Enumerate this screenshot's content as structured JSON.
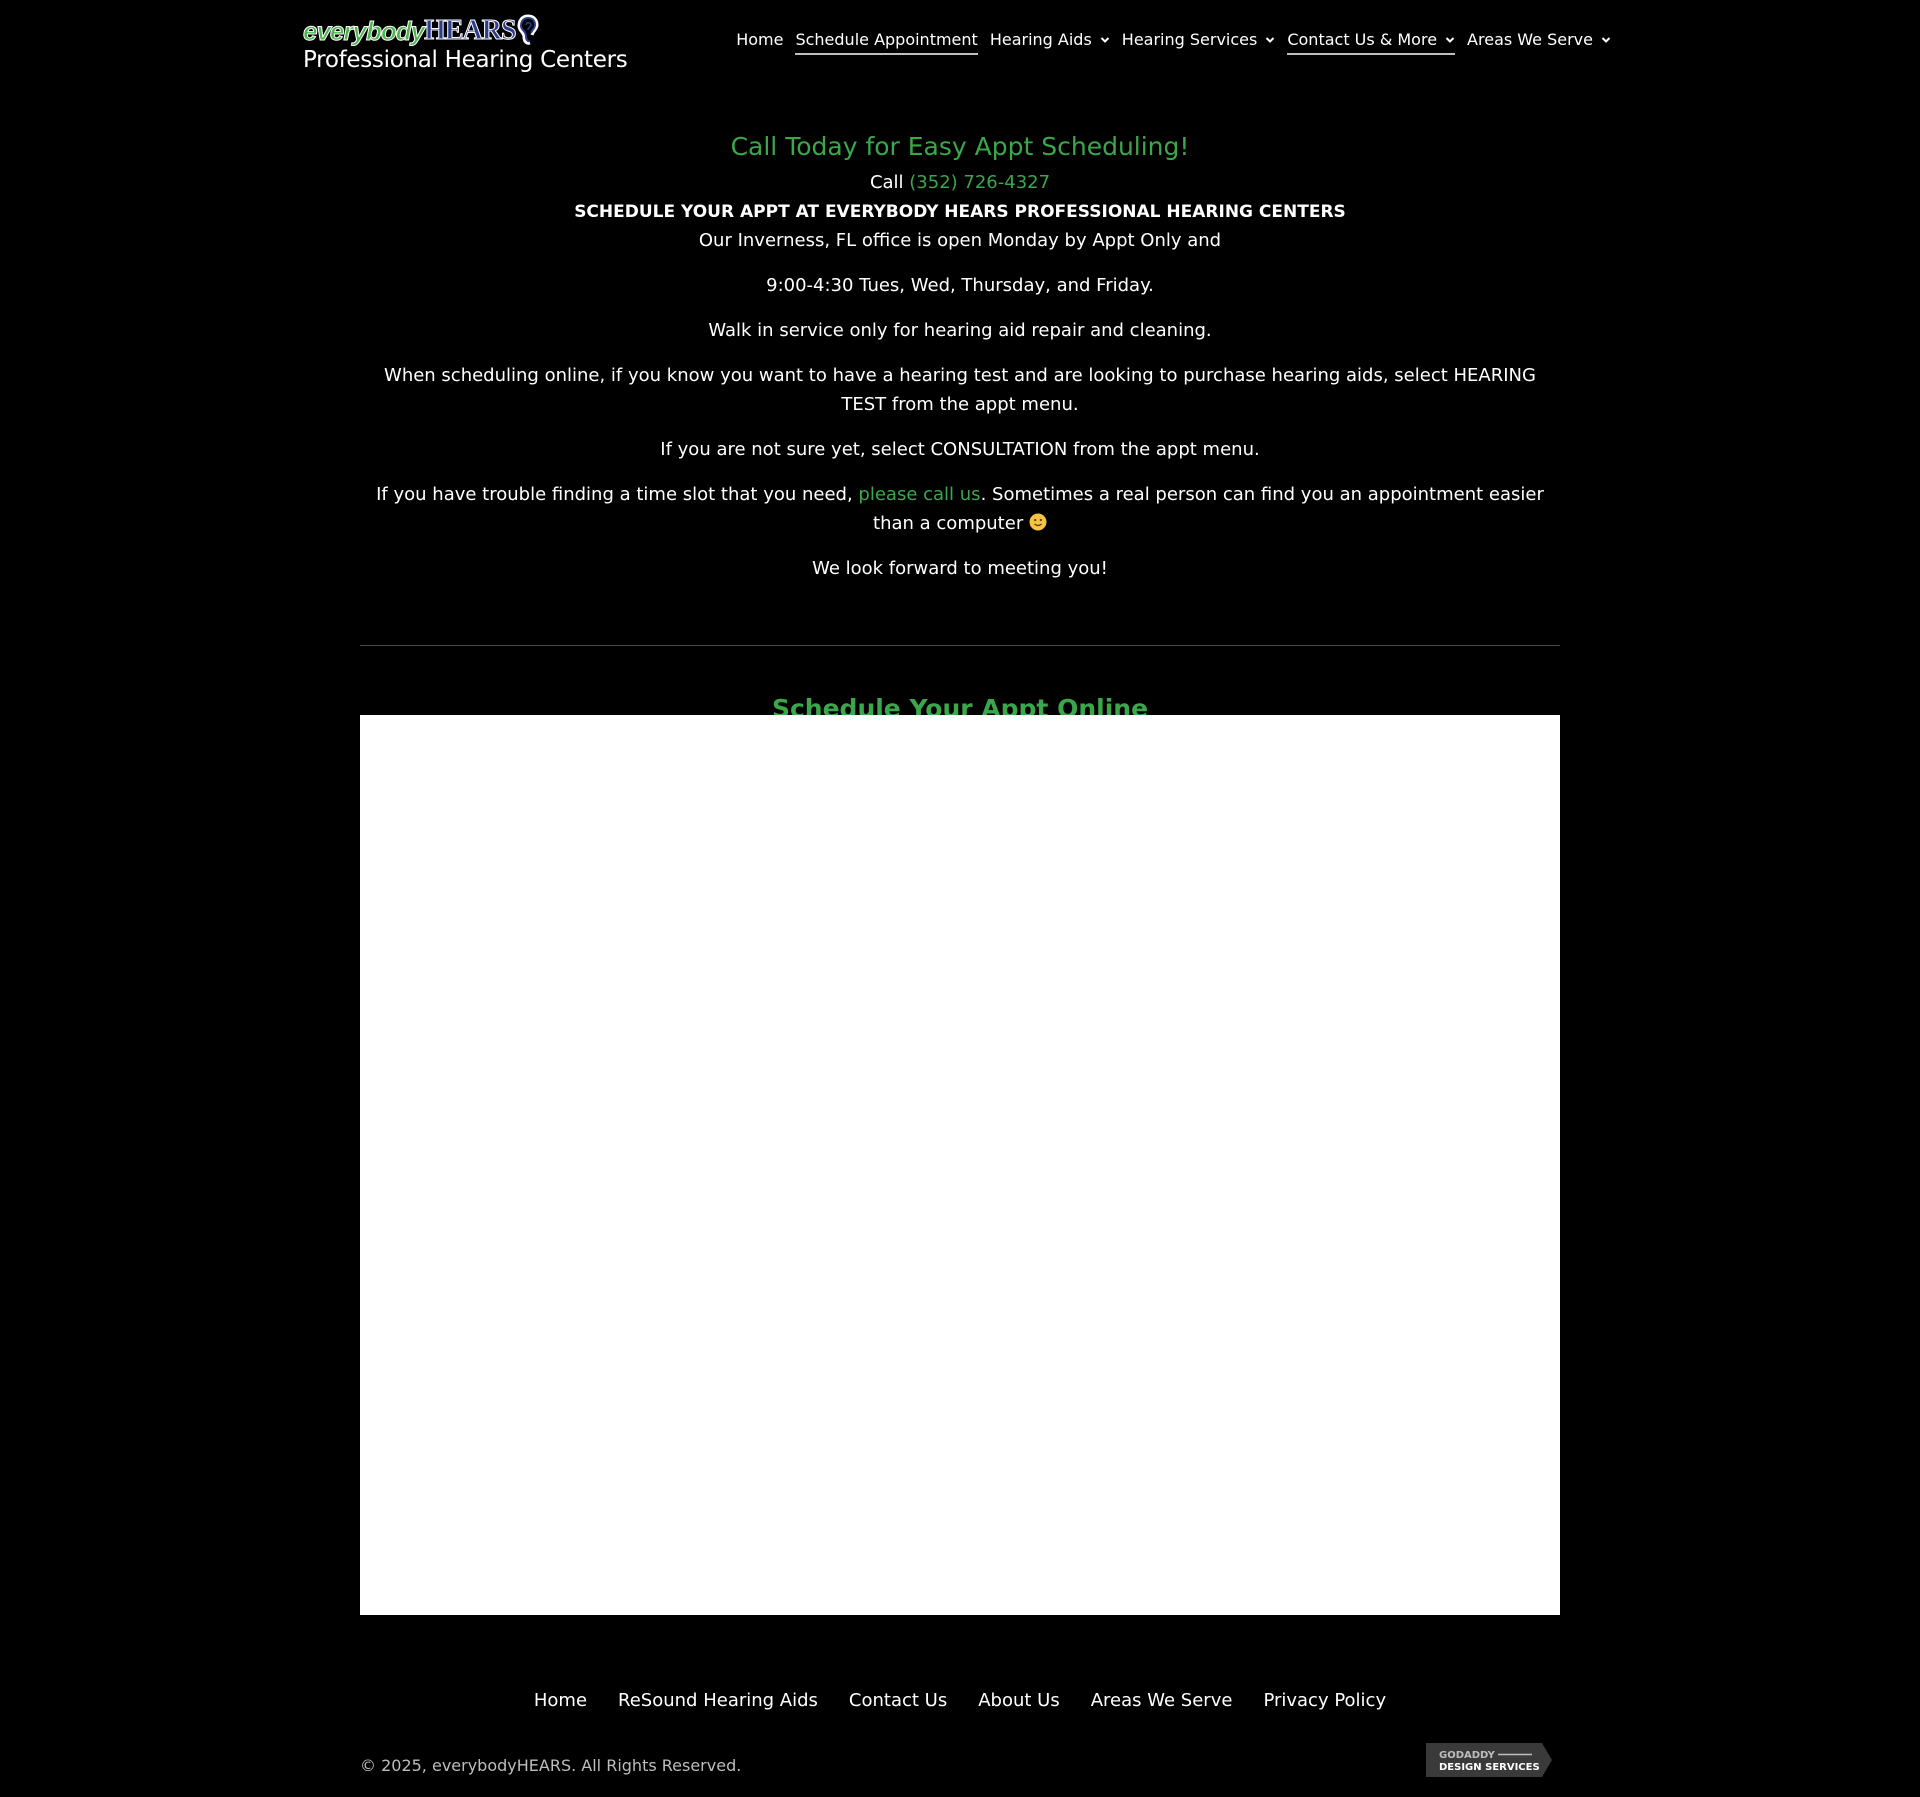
{
  "header": {
    "logo": {
      "word1": "everybody",
      "word2": "HEARS",
      "tagline": "Professional Hearing Centers"
    },
    "nav": [
      {
        "label": "Home",
        "active": false,
        "dropdown": false
      },
      {
        "label": "Schedule Appointment",
        "active": true,
        "dropdown": false
      },
      {
        "label": "Hearing Aids",
        "active": false,
        "dropdown": true
      },
      {
        "label": "Hearing Services",
        "active": false,
        "dropdown": true
      },
      {
        "label": "Contact Us & More",
        "active": true,
        "dropdown": true
      },
      {
        "label": "Areas We Serve",
        "active": false,
        "dropdown": true
      }
    ]
  },
  "main": {
    "heading": "Call Today for Easy Appt Scheduling!",
    "call_prefix": "Call ",
    "phone": "(352) 726-4327",
    "bold_line": "SCHEDULE YOUR APPT AT EVERYBODY HEARS PROFESSIONAL HEARING CENTERS",
    "hours_line1": "Our Inverness, FL office is open Monday by Appt Only and",
    "hours_line2": "9:00-4:30 Tues, Wed, Thursday, and Friday.",
    "walkin": "Walk in service only for hearing aid repair and cleaning.",
    "hearing_test_note": "When scheduling online, if you know you want to have a hearing test and are looking to purchase hearing aids, select HEARING TEST from the appt menu.",
    "consultation_note": "If you are not sure yet, select CONSULTATION from the appt menu.",
    "trouble_prefix": "If you have trouble finding a time slot that you need, ",
    "trouble_link": "please call us",
    "trouble_suffix": ". Sometimes a real person can find you an appointment easier than a computer ",
    "closing": "We look forward to meeting you!",
    "online_heading": "Schedule Your Appt Online"
  },
  "footer": {
    "links": [
      "Home",
      "ReSound Hearing Aids",
      "Contact Us",
      "About Us",
      "Areas We Serve",
      "Privacy Policy"
    ],
    "copyright": "© 2025, everybodyHEARS. All Rights Reserved.",
    "badge_line1": "GODADDY",
    "badge_line2": "DESIGN SERVICES"
  },
  "colors": {
    "background": "#000000",
    "accent_green": "#3aa84a",
    "logo_blue": "#2c3e8c"
  },
  "icons": [
    "ear-icon",
    "chevron-down-icon",
    "smiley-icon"
  ]
}
